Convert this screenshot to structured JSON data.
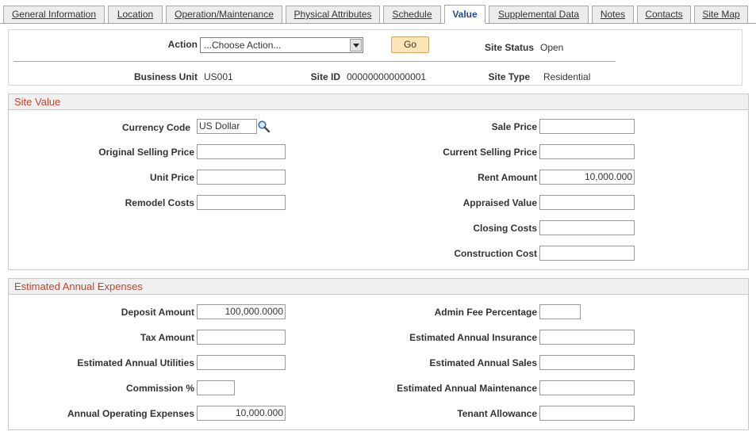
{
  "tabs": [
    {
      "label": "General Information",
      "active": false
    },
    {
      "label": "Location",
      "active": false
    },
    {
      "label": "Operation/Maintenance",
      "active": false
    },
    {
      "label": "Physical Attributes",
      "active": false
    },
    {
      "label": "Schedule",
      "active": false
    },
    {
      "label": "Value",
      "active": true
    },
    {
      "label": "Supplemental Data",
      "active": false
    },
    {
      "label": "Notes",
      "active": false
    },
    {
      "label": "Contacts",
      "active": false
    },
    {
      "label": "Site Map",
      "active": false
    }
  ],
  "header": {
    "action_label": "Action",
    "action_value": "...Choose Action...",
    "go_label": "Go",
    "site_status_label": "Site Status",
    "site_status_value": "Open",
    "business_unit_label": "Business Unit",
    "business_unit_value": "US001",
    "site_id_label": "Site ID",
    "site_id_value": "000000000000001",
    "site_type_label": "Site Type",
    "site_type_value": "Residential"
  },
  "site_value": {
    "title": "Site Value",
    "currency_code_label": "Currency Code",
    "currency_code_value": "US Dollar",
    "original_selling_price_label": "Original Selling Price",
    "original_selling_price_value": "",
    "unit_price_label": "Unit Price",
    "unit_price_value": "",
    "remodel_costs_label": "Remodel Costs",
    "remodel_costs_value": "",
    "sale_price_label": "Sale Price",
    "sale_price_value": "",
    "current_selling_price_label": "Current Selling Price",
    "current_selling_price_value": "",
    "rent_amount_label": "Rent Amount",
    "rent_amount_value": "10,000.000",
    "appraised_value_label": "Appraised Value",
    "appraised_value_value": "",
    "closing_costs_label": "Closing Costs",
    "closing_costs_value": "",
    "construction_cost_label": "Construction Cost",
    "construction_cost_value": ""
  },
  "expenses": {
    "title": "Estimated Annual Expenses",
    "deposit_amount_label": "Deposit Amount",
    "deposit_amount_value": "100,000.0000",
    "tax_amount_label": "Tax Amount",
    "tax_amount_value": "",
    "est_annual_utilities_label": "Estimated Annual Utilities",
    "est_annual_utilities_value": "",
    "commission_label": "Commission %",
    "commission_value": "",
    "annual_operating_expenses_label": "Annual Operating Expenses",
    "annual_operating_expenses_value": "10,000.000",
    "admin_fee_percentage_label": "Admin Fee Percentage",
    "admin_fee_percentage_value": "",
    "est_annual_insurance_label": "Estimated Annual Insurance",
    "est_annual_insurance_value": "",
    "est_annual_sales_label": "Estimated Annual Sales",
    "est_annual_sales_value": "",
    "est_annual_maintenance_label": "Estimated Annual Maintenance",
    "est_annual_maintenance_value": "",
    "tenant_allowance_label": "Tenant Allowance",
    "tenant_allowance_value": ""
  },
  "colors": {
    "section_title": "#c0452a",
    "active_tab_text": "#1f4b8f",
    "go_button_bg": "#fbe5b6"
  },
  "icons": {
    "lookup": "magnifier-icon",
    "dropdown": "chevron-down-icon"
  }
}
